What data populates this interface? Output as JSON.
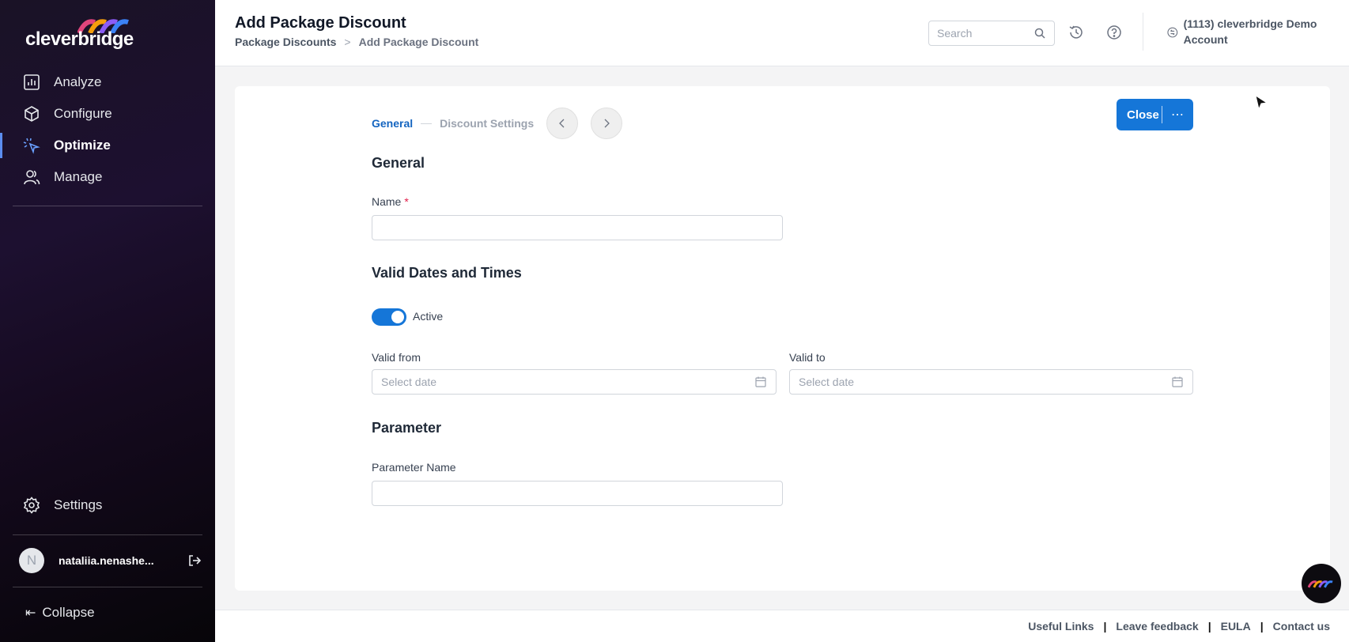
{
  "sidebar": {
    "brand": "cleverbridge",
    "items": [
      {
        "label": "Analyze",
        "icon": "bar-chart-icon"
      },
      {
        "label": "Configure",
        "icon": "cube-icon"
      },
      {
        "label": "Optimize",
        "icon": "sparkle-cursor-icon",
        "active": true
      },
      {
        "label": "Manage",
        "icon": "users-icon"
      }
    ],
    "settings_label": "Settings",
    "user_initial": "N",
    "user_name": "nataliia.nenashe...",
    "collapse_label": "Collapse"
  },
  "header": {
    "title": "Add Package Discount",
    "breadcrumb": {
      "parent": "Package Discounts",
      "separator": ">",
      "current": "Add Package Discount"
    },
    "search_placeholder": "Search",
    "account_label": "(1113) cleverbridge Demo Account"
  },
  "wizard": {
    "step1": "General",
    "step2": "Discount Settings",
    "close_label": "Close",
    "more_label": "⋯"
  },
  "form": {
    "general_title": "General",
    "name_label": "Name",
    "name_required": "*",
    "name_value": "",
    "valid_title": "Valid Dates and Times",
    "active_label": "Active",
    "active": true,
    "valid_from_label": "Valid from",
    "valid_from_placeholder": "Select date",
    "valid_to_label": "Valid to",
    "valid_to_placeholder": "Select date",
    "parameter_title": "Parameter",
    "parameter_name_label": "Parameter Name",
    "parameter_name_value": ""
  },
  "footer": {
    "links": [
      "Useful Links",
      "Leave feedback",
      "EULA",
      "Contact us"
    ]
  },
  "colors": {
    "accent": "#1576d8",
    "sidebar_active_bar": "#5b8def"
  }
}
